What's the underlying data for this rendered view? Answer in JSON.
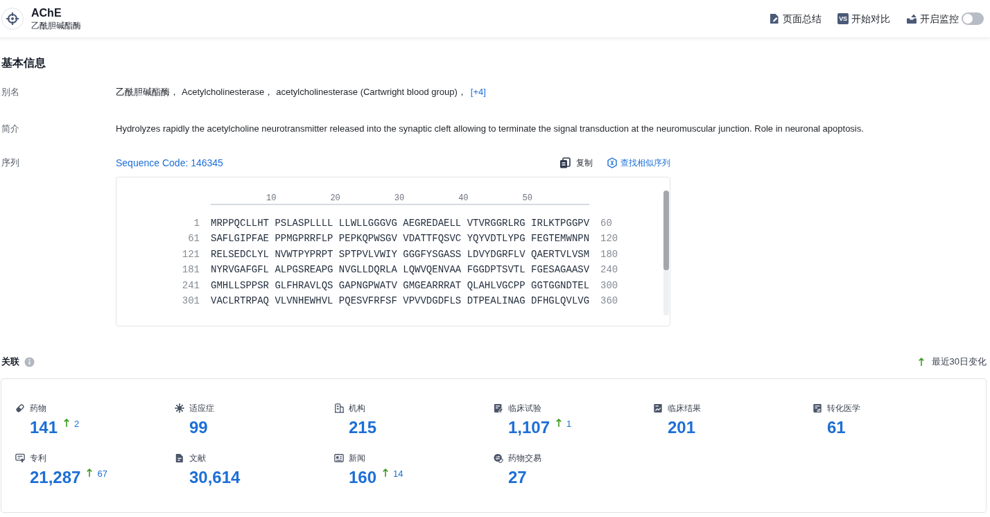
{
  "header": {
    "title": "AChE",
    "subtitle": "乙酰胆碱酯酶",
    "actions": [
      {
        "kind": "summary",
        "label": "页面总结"
      },
      {
        "kind": "compare",
        "badge": "VS",
        "label": "开始对比"
      },
      {
        "kind": "monitor",
        "label": "开启监控",
        "on": false
      }
    ]
  },
  "basic_info": {
    "title": "基本信息",
    "fields": [
      {
        "kind": "aliases",
        "label": "别名",
        "items": [
          "乙酰胆碱酯酶，",
          "Acetylcholinesterase，",
          "acetylcholinesterase (Cartwright blood group)，"
        ],
        "more": "[+4]"
      },
      {
        "kind": "text",
        "label": "简介",
        "text": "Hydrolyzes rapidly the acetylcholine neurotransmitter released into the synaptic cleft allowing to terminate the signal transduction at the neuromuscular junction. Role in neuronal apoptosis."
      },
      {
        "kind": "sequence",
        "label": "序列",
        "code": "Sequence Code: 146345",
        "actions": [
          {
            "kind": "copy",
            "label": "复制"
          },
          {
            "kind": "find_similar",
            "label": "查找相似序列"
          }
        ],
        "ruler": [
          "10",
          "20",
          "30",
          "40",
          "50"
        ],
        "rows": [
          {
            "start": "1",
            "residues": "MRPPQCLLHT PSLASPLLLL LLWLLGGGVG AEGREDAELL VTVRGGRLRG IRLKTPGGPV",
            "end": "60"
          },
          {
            "start": "61",
            "residues": "SAFLGIPFAE PPMGPRRFLP PEPKQPWSGV VDATTFQSVC YQYVDTLYPG FEGTEMWNPN",
            "end": "120"
          },
          {
            "start": "121",
            "residues": "RELSEDCLYL NVWTPYPRPT SPTPVLVWIY GGGFYSGASS LDVYDGRFLV QAERTVLVSM",
            "end": "180"
          },
          {
            "start": "181",
            "residues": "NYRVGAFGFL ALPGSREAPG NVGLLDQRLA LQWVQENVAA FGGDPTSVTL FGESAGAASV",
            "end": "240"
          },
          {
            "start": "241",
            "residues": "GMHLLSPPSR GLFHRAVLQS GAPNGPWATV GMGEARRRAT QLAHLVGCPP GGTGGNDTEL",
            "end": "300"
          },
          {
            "start": "301",
            "residues": "VACLRTRPAQ VLVNHEWHVL PQESVFRFSF VPVVDGDFLS DTPEALINAG DFHGLQVLVG",
            "end": "360"
          }
        ]
      }
    ]
  },
  "related": {
    "title": "关联",
    "legend": "最近30日变化",
    "stats": [
      {
        "kind": "drug",
        "label": "药物",
        "value": "141",
        "change": "2"
      },
      {
        "kind": "indication",
        "label": "适应症",
        "value": "99"
      },
      {
        "kind": "organization",
        "label": "机构",
        "value": "215"
      },
      {
        "kind": "clinical_trial",
        "label": "临床试验",
        "value": "1,107",
        "change": "1"
      },
      {
        "kind": "clinical_result",
        "label": "临床结果",
        "value": "201"
      },
      {
        "kind": "translational",
        "label": "转化医学",
        "value": "61"
      },
      {
        "kind": "patent",
        "label": "专利",
        "value": "21,287",
        "change": "67"
      },
      {
        "kind": "literature",
        "label": "文献",
        "value": "30,614"
      },
      {
        "kind": "news",
        "label": "新闻",
        "value": "160",
        "change": "14"
      },
      {
        "kind": "deal",
        "label": "药物交易",
        "value": "27"
      }
    ]
  }
}
